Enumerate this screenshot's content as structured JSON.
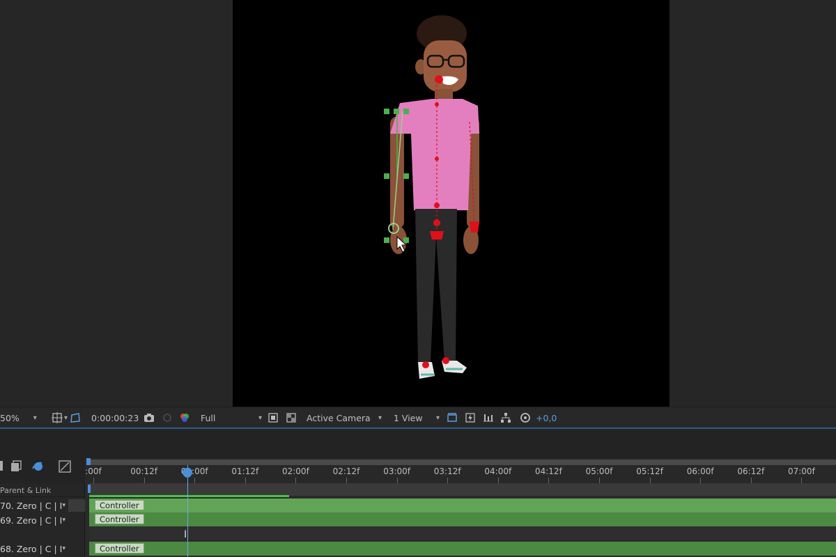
{
  "viewer_bar": {
    "zoom": "50%",
    "timecode": "0:00:00:23",
    "resolution": "Full",
    "camera": "Active Camera",
    "view_layout": "1 View",
    "exposure": "+0,0"
  },
  "timeline": {
    "column_header": "Parent & Link",
    "ruler_ticks": [
      ":00f",
      "00:12f",
      "01:00f",
      "01:12f",
      "02:00f",
      "02:12f",
      "03:00f",
      "03:12f",
      "04:00f",
      "04:12f",
      "05:00f",
      "05:12f",
      "06:00f",
      "06:12f",
      "07:00f"
    ],
    "layers": [
      {
        "parent": "70. Zero | C | I",
        "clip_label": "Controller"
      },
      {
        "parent": "69. Zero | C | I",
        "clip_label": "Controller"
      },
      {
        "parent": "",
        "clip_label": ""
      },
      {
        "parent": "68. Zero | C | I",
        "clip_label": "Controller"
      }
    ]
  },
  "colors": {
    "accent_blue": "#4a90d9",
    "clip_green": "#4c8a43",
    "work_area_green": "#49c249",
    "handle_green": "#4caf50",
    "pin_red": "#e0101a"
  }
}
